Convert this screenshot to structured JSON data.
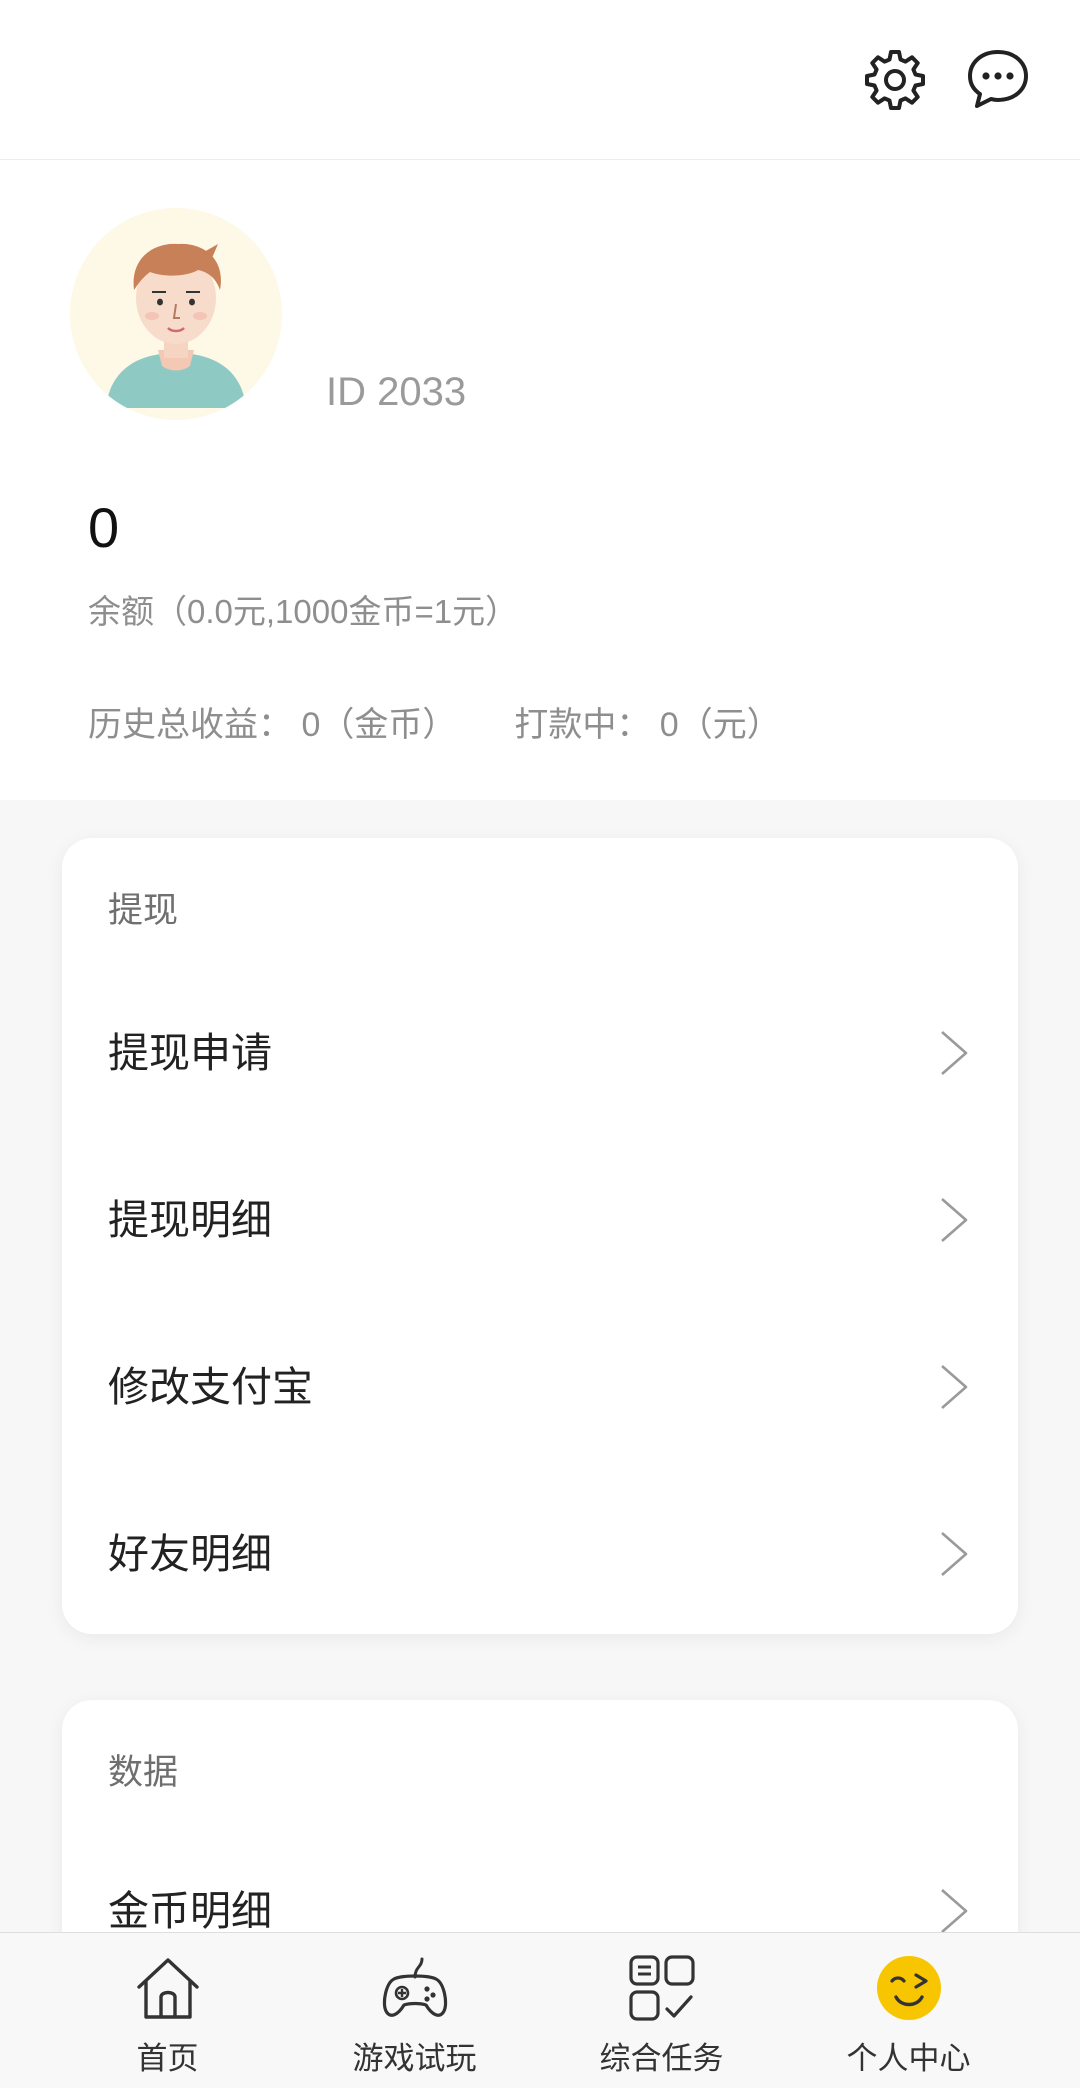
{
  "header": {
    "settings_icon": "gear-icon",
    "messages_icon": "chat-bubble-icon"
  },
  "profile": {
    "user_id": "ID 2033",
    "balance": "0",
    "balance_desc": "余额（0.0元,1000金币=1元）",
    "total_earnings": "历史总收益： 0（金币）",
    "pending_payout": "打款中： 0（元）"
  },
  "withdraw_section": {
    "title": "提现",
    "items": [
      {
        "label": "提现申请"
      },
      {
        "label": "提现明细"
      },
      {
        "label": "修改支付宝"
      },
      {
        "label": "好友明细"
      }
    ]
  },
  "data_section": {
    "title": "数据",
    "items": [
      {
        "label": "金币明细"
      }
    ]
  },
  "tabbar": {
    "tabs": [
      {
        "label": "首页",
        "icon": "home-icon"
      },
      {
        "label": "游戏试玩",
        "icon": "gamepad-icon"
      },
      {
        "label": "综合任务",
        "icon": "tasks-grid-icon"
      },
      {
        "label": "个人中心",
        "icon": "wink-face-icon",
        "active": true
      }
    ]
  },
  "colors": {
    "active_tab": "#f7c600",
    "page_bg": "#f7f7f7",
    "card_bg": "#ffffff"
  }
}
